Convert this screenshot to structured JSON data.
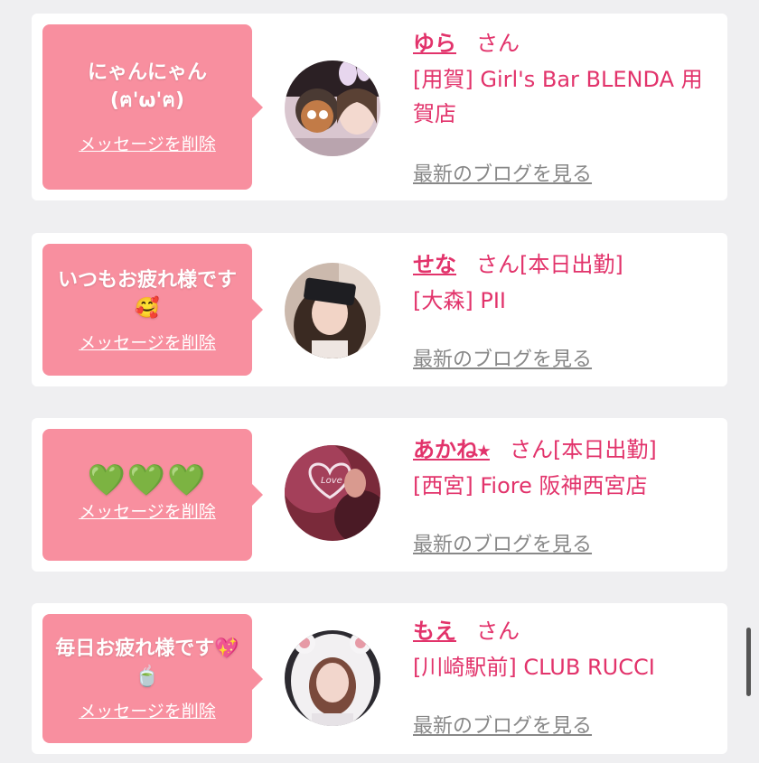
{
  "cards": [
    {
      "message": "にゃんにゃん(ฅ'ω'ฅ)",
      "delete_label": "メッセージを削除",
      "name": "ゆら",
      "honorific": "さん",
      "status": "",
      "shop": "[用賀] Girl's Bar BLENDA 用賀店",
      "blog_label": "最新のブログを見る"
    },
    {
      "message": "いつもお疲れ様です🥰",
      "delete_label": "メッセージを削除",
      "name": "せな",
      "honorific": "さん",
      "status": "[本日出勤]",
      "shop": "[大森] PII",
      "blog_label": "最新のブログを見る"
    },
    {
      "message": "💚💚💚",
      "delete_label": "メッセージを削除",
      "name": "あかね⭑",
      "honorific": "さん",
      "status": "[本日出勤]",
      "shop": "[西宮] Fiore 阪神西宮店",
      "blog_label": "最新のブログを見る"
    },
    {
      "message": "毎日お疲れ様です💖🍵",
      "delete_label": "メッセージを削除",
      "name": "もえ",
      "honorific": "さん",
      "status": "",
      "shop": "[川崎駅前] CLUB RUCCI",
      "blog_label": "最新のブログを見る"
    }
  ],
  "colors": {
    "bubble": "#f88f9f",
    "accent": "#e2336b",
    "link_gray": "#888888",
    "background": "#efeff1"
  }
}
